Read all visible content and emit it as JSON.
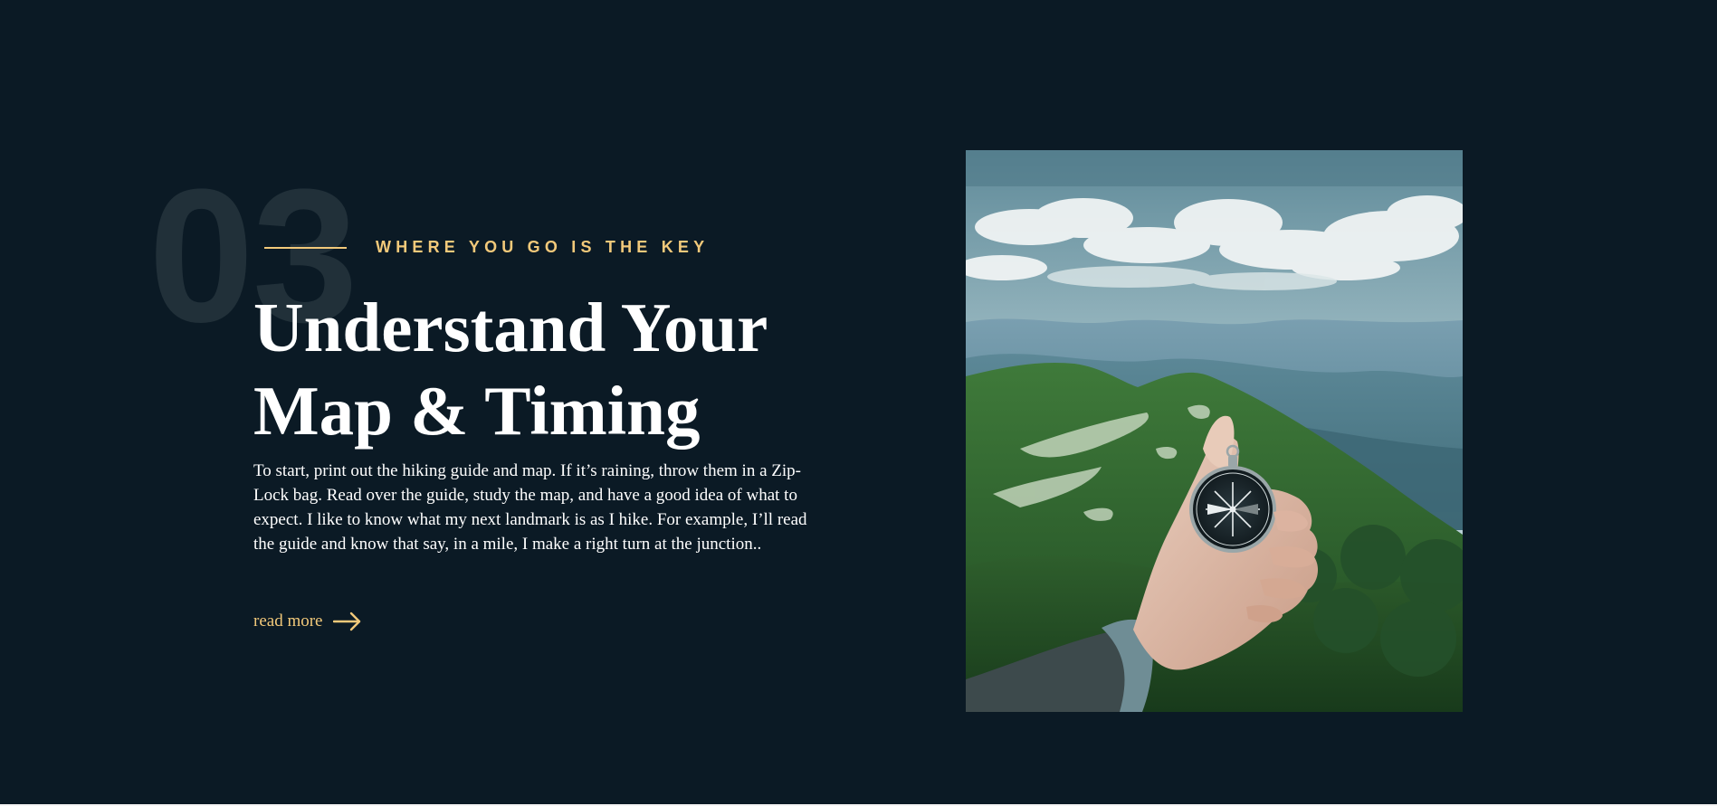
{
  "section": {
    "number": "03",
    "eyebrow": "WHERE YOU GO IS THE KEY",
    "title_line_1": "Understand Your",
    "title_line_2": "Map & Timing",
    "body": "To start, print out the hiking guide and map. If it’s raining, throw them in a Zip-Lock bag. Read over the guide, study the map, and have a good idea of what to expect. I like to know what my next landmark is as I hike. For example, I’ll read the guide and know that say, in a mile, I make a right turn at the junction..",
    "read_more_label": "read more"
  },
  "icons": {
    "read_more": "arrow-right-icon"
  },
  "colors": {
    "background": "#0b1a25",
    "accent": "#f2c97a",
    "number": "#213039",
    "text": "#ffffff"
  }
}
